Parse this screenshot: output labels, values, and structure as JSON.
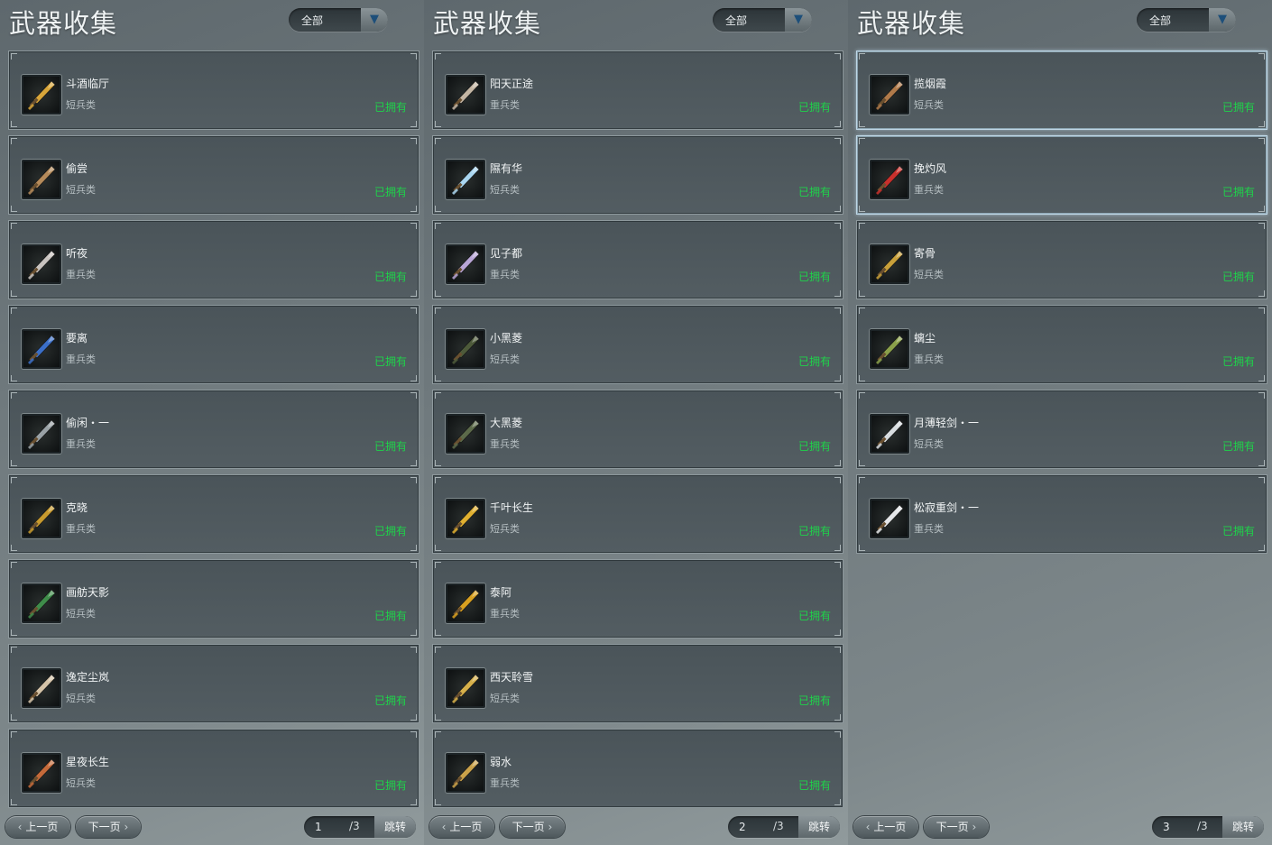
{
  "panels": [
    {
      "title": "武器收集",
      "filter": "全部",
      "items": [
        {
          "name": "斗酒临厅",
          "type": "短兵类",
          "status": "已拥有",
          "icon": "golden-dragon-dagger-icon",
          "color": "#d8a63a"
        },
        {
          "name": "偷尝",
          "type": "短兵类",
          "status": "已拥有",
          "icon": "bronze-sword-hilt-icon",
          "color": "#b48a5a"
        },
        {
          "name": "听夜",
          "type": "重兵类",
          "status": "已拥有",
          "icon": "silver-curved-blade-icon",
          "color": "#c9c4c0"
        },
        {
          "name": "要离",
          "type": "重兵类",
          "status": "已拥有",
          "icon": "blue-crystal-blade-icon",
          "color": "#3b6fc7"
        },
        {
          "name": "偷闲・一",
          "type": "重兵类",
          "status": "已拥有",
          "icon": "steel-spear-head-icon",
          "color": "#9aa2a6"
        },
        {
          "name": "克晓",
          "type": "重兵类",
          "status": "已拥有",
          "icon": "gold-leaf-blade-icon",
          "color": "#c79a2e"
        },
        {
          "name": "画舫天影",
          "type": "短兵类",
          "status": "已拥有",
          "icon": "jade-dagger-icon",
          "color": "#3f8c4a"
        },
        {
          "name": "逸定尘岚",
          "type": "短兵类",
          "status": "已拥有",
          "icon": "ornate-silver-dagger-icon",
          "color": "#d4c3a8"
        },
        {
          "name": "星夜长生",
          "type": "短兵类",
          "status": "已拥有",
          "icon": "copper-dagger-icon",
          "color": "#c46a3a"
        }
      ],
      "pager": {
        "prev": "上一页",
        "next": "下一页",
        "page": "1",
        "total": "/3",
        "jump": "跳转"
      }
    },
    {
      "title": "武器收集",
      "filter": "全部",
      "items": [
        {
          "name": "阳天正途",
          "type": "重兵类",
          "status": "已拥有",
          "icon": "stone-blade-icon",
          "color": "#c4b6a4"
        },
        {
          "name": "隰有华",
          "type": "短兵类",
          "status": "已拥有",
          "icon": "ice-crystal-staff-icon",
          "color": "#a9d6f0"
        },
        {
          "name": "见子都",
          "type": "重兵类",
          "status": "已拥有",
          "icon": "amethyst-blade-icon",
          "color": "#b9a6d6"
        },
        {
          "name": "小黑菱",
          "type": "短兵类",
          "status": "已拥有",
          "icon": "dark-lattice-blade-icon",
          "color": "#4d5a3a"
        },
        {
          "name": "大黑菱",
          "type": "重兵类",
          "status": "已拥有",
          "icon": "dark-green-blade-icon",
          "color": "#5c6a4a"
        },
        {
          "name": "千叶长生",
          "type": "短兵类",
          "status": "已拥有",
          "icon": "golden-ring-staff-icon",
          "color": "#e0b030"
        },
        {
          "name": "泰阿",
          "type": "重兵类",
          "status": "已拥有",
          "icon": "black-gold-blade-icon",
          "color": "#d8a020"
        },
        {
          "name": "西天聆雪",
          "type": "短兵类",
          "status": "已拥有",
          "icon": "golden-trident-icon",
          "color": "#d6b04a"
        },
        {
          "name": "弱水",
          "type": "重兵类",
          "status": "已拥有",
          "icon": "golden-sword-icon",
          "color": "#caa24a"
        }
      ],
      "pager": {
        "prev": "上一页",
        "next": "下一页",
        "page": "2",
        "total": "/3",
        "jump": "跳转"
      }
    },
    {
      "title": "武器收集",
      "filter": "全部",
      "items": [
        {
          "name": "揽烟霞",
          "type": "短兵类",
          "status": "已拥有",
          "icon": "ornate-bronze-dagger-icon",
          "color": "#b07a4a",
          "selected": true
        },
        {
          "name": "挽灼风",
          "type": "重兵类",
          "status": "已拥有",
          "icon": "crimson-blade-icon",
          "color": "#c8302c",
          "selected": true
        },
        {
          "name": "寄骨",
          "type": "短兵类",
          "status": "已拥有",
          "icon": "golden-bone-dagger-icon",
          "color": "#c8a03a"
        },
        {
          "name": "螭尘",
          "type": "重兵类",
          "status": "已拥有",
          "icon": "jade-gold-blade-icon",
          "color": "#8aa04a"
        },
        {
          "name": "月薄轻剑・一",
          "type": "短兵类",
          "status": "已拥有",
          "icon": "silver-serrated-sword-icon",
          "color": "#d8dde0"
        },
        {
          "name": "松寂重剑・一",
          "type": "重兵类",
          "status": "已拥有",
          "icon": "white-broad-sword-icon",
          "color": "#e4e6e8"
        }
      ],
      "pager": {
        "prev": "上一页",
        "next": "下一页",
        "page": "3",
        "total": "/3",
        "jump": "跳转"
      }
    }
  ]
}
